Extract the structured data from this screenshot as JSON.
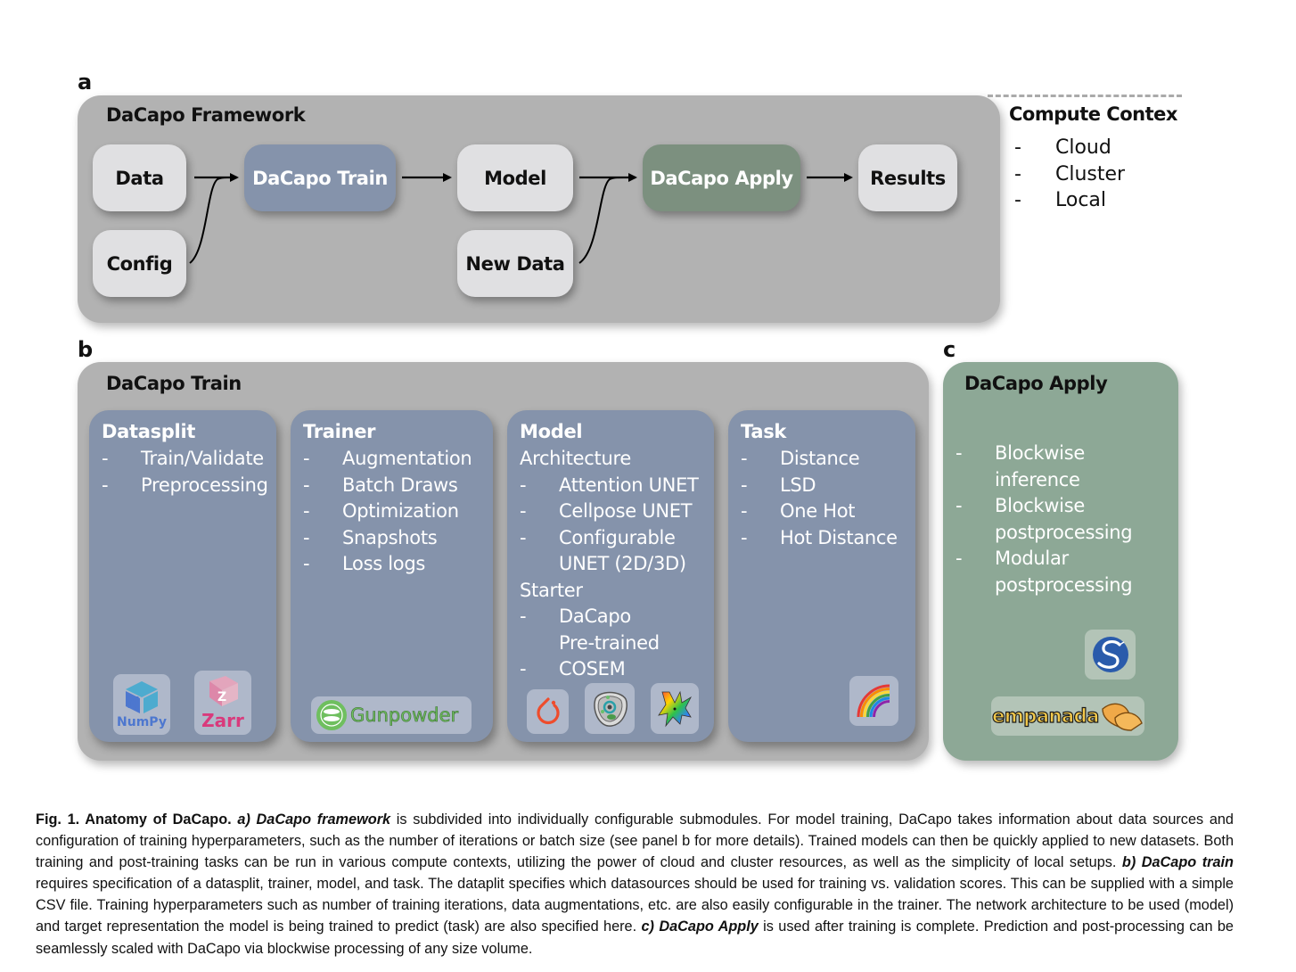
{
  "panel_letters": {
    "a": "a",
    "b": "b",
    "c": "c"
  },
  "framework": {
    "title": "DaCapo Framework",
    "nodes": {
      "data": "Data",
      "config": "Config",
      "train": "DaCapo Train",
      "model": "Model",
      "new_data": "New Data",
      "apply": "DaCapo Apply",
      "results": "Results"
    },
    "colors": {
      "frame": "#b2b2b2",
      "node_light": "#e0e0e2",
      "train": "#8593ab",
      "apply": "#7c907f"
    }
  },
  "compute_context": {
    "title": "Compute Contex",
    "dash": "-",
    "items": [
      "Cloud",
      "Cluster",
      "Local"
    ]
  },
  "train_panel": {
    "title": "DaCapo Train",
    "dash": "-",
    "cards": {
      "datasplit": {
        "title": "Datasplit",
        "items": [
          "Train/Validate",
          "Preprocessing"
        ],
        "logos": [
          "NumPy",
          "Zarr"
        ]
      },
      "trainer": {
        "title": "Trainer",
        "items": [
          "Augmentation",
          "Batch Draws",
          "Optimization",
          "Snapshots",
          "Loss logs"
        ],
        "logos": [
          "Gunpowder"
        ]
      },
      "model": {
        "title": "Model",
        "architecture_heading": "Architecture",
        "architecture": [
          "Attention UNET",
          "Cellpose UNET",
          "Configurable",
          "UNET (2D/3D)"
        ],
        "starter_heading": "Starter",
        "starter": [
          "DaCapo",
          "Pre-trained",
          "COSEM"
        ],
        "logos": [
          "pytorch-icon",
          "cell-icon",
          "neuron-icon"
        ]
      },
      "task": {
        "title": "Task",
        "items": [
          "Distance",
          "LSD",
          "One Hot",
          "Hot Distance"
        ],
        "logos": [
          "rainbow-icon"
        ]
      }
    }
  },
  "apply_panel": {
    "title": "DaCapo Apply",
    "dash": "-",
    "items": [
      {
        "line1": "Blockwise",
        "line2": "inference"
      },
      {
        "line1": "Blockwise",
        "line2": "postprocessing"
      },
      {
        "line1": "Modular",
        "line2": "postprocessing"
      }
    ],
    "logos": [
      "scipy-icon",
      "empanada"
    ],
    "colors": {
      "frame": "#8da896"
    }
  },
  "caption": {
    "fig_label": "Fig. 1.  Anatomy of DaCapo.",
    "a_label": "a) DaCapo framework",
    "a_text": " is subdivided into individually configurable submodules.  For model training, DaCapo takes information about data sources and configuration of training hyperparameters, such as the number of iterations or batch size (see panel b for more details).  Trained models can then be quickly applied to new datasets.  Both training and post-training tasks can be run in various compute contexts, utilizing the power of cloud and cluster resources, as well as the simplicity of local setups. ",
    "b_label": "b) DaCapo train",
    "b_text": " requires specification of a datasplit, trainer, model, and task. The dataplit specifies which datasources should be used for training vs. validation scores. This can be supplied with a simple CSV file. Training hyperparameters such as number of training iterations, data augmentations, etc. are also easily configurable in the trainer.  The network architecture to be used (model) and target representation the model is being trained to predict (task) are also specified here.  ",
    "c_label": "c) DaCapo Apply",
    "c_text": " is used after training is complete. Prediction and post-processing can be seamlessly scaled with DaCapo via blockwise processing of any size volume."
  }
}
